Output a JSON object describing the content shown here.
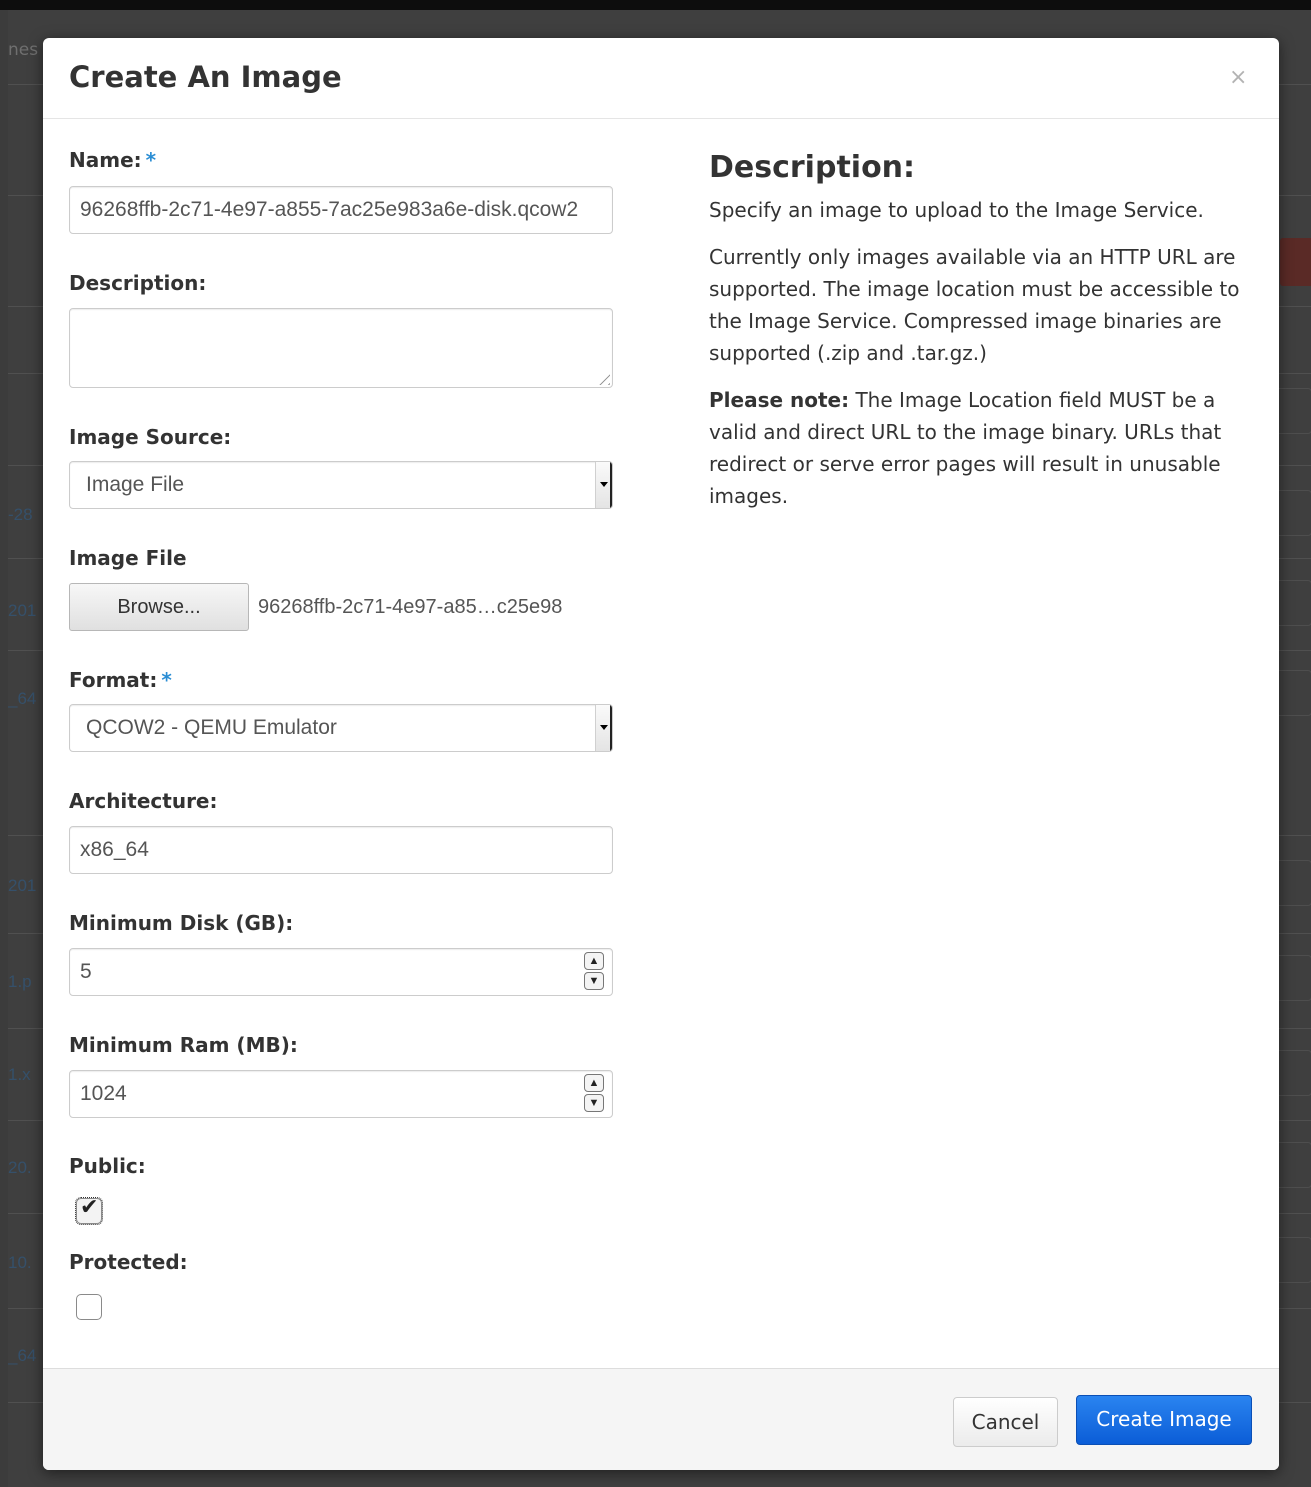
{
  "background": {
    "header_text": "nes",
    "row_fragments": [
      "-28",
      "201",
      "_64",
      "201",
      "1.p",
      "1.x",
      "20.",
      "10.",
      "_64"
    ]
  },
  "modal": {
    "title": "Create An Image",
    "close_symbol": "×",
    "required_marker": "*",
    "fields": {
      "name": {
        "label": "Name:",
        "value": "96268ffb-2c71-4e97-a855-7ac25e983a6e-disk.qcow2"
      },
      "description": {
        "label": "Description:",
        "value": ""
      },
      "image_source": {
        "label": "Image Source:",
        "value": "Image File"
      },
      "image_file": {
        "label": "Image File",
        "browse_label": "Browse...",
        "file_name": "96268ffb-2c71-4e97-a85…c25e98"
      },
      "format": {
        "label": "Format:",
        "value": "QCOW2 - QEMU Emulator"
      },
      "architecture": {
        "label": "Architecture:",
        "value": "x86_64"
      },
      "min_disk": {
        "label": "Minimum Disk (GB):",
        "value": "5"
      },
      "min_ram": {
        "label": "Minimum Ram (MB):",
        "value": "1024"
      },
      "public": {
        "label": "Public:",
        "checked": true
      },
      "protected": {
        "label": "Protected:",
        "checked": false
      }
    },
    "help": {
      "heading": "Description:",
      "paragraph1": "Specify an image to upload to the Image Service.",
      "paragraph2": "Currently only images available via an HTTP URL are supported. The image location must be accessible to the Image Service. Compressed image binaries are supported (.zip and .tar.gz.)",
      "note_label": "Please note:",
      "note_text": " The Image Location field MUST be a valid and direct URL to the image binary. URLs that redirect or serve error pages will result in unusable images."
    },
    "footer": {
      "cancel_label": "Cancel",
      "create_label": "Create Image"
    }
  },
  "colors": {
    "primary": "#0b5dd7",
    "required": "#2a8dd4",
    "backdrop": "#3c3c3c"
  }
}
